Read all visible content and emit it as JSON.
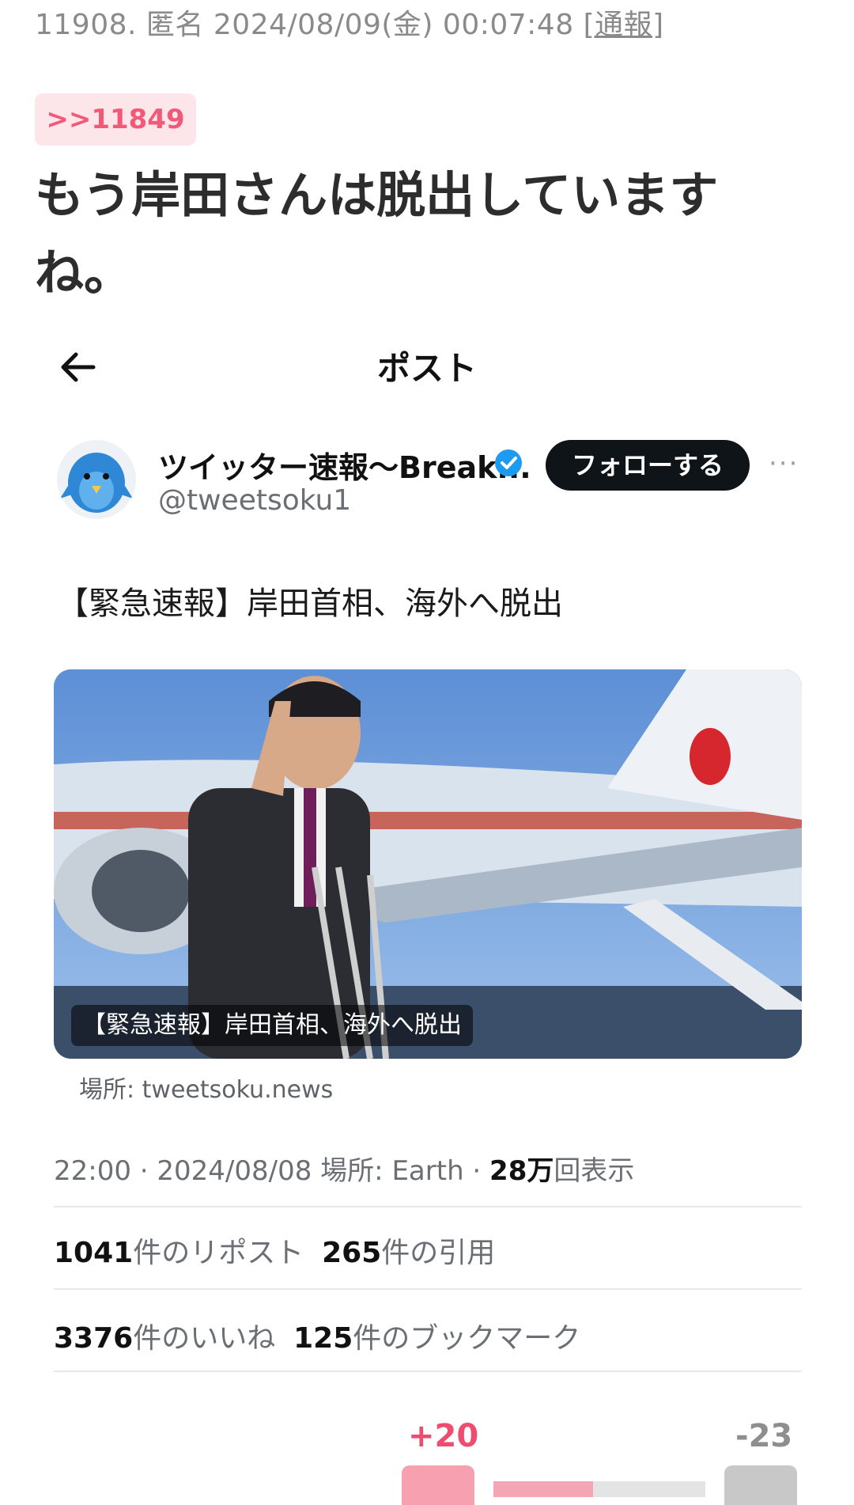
{
  "comment": {
    "number": "11908.",
    "author": "匿名",
    "datetime": "2024/08/09(金) 00:07:48",
    "report_label": "[通報]",
    "reply_anchor": ">>11849",
    "body": "もう岸田さんは脱出していますね。"
  },
  "embed": {
    "header_title": "ポスト",
    "account_name": "ツイッター速報〜Break...",
    "handle": "@tweetsoku1",
    "follow_label": "フォローする",
    "more_label": "···",
    "text": "【緊急速報】岸田首相、海外へ脱出",
    "media_caption": "【緊急速報】岸田首相、海外へ脱出",
    "source": "場所: tweetsoku.news",
    "timeline_prefix": "22:00 · 2024/08/08  場所: Earth · ",
    "views_count": "28万",
    "views_suffix": "回表示",
    "reposts_count": "1041",
    "reposts_label": "件のリポスト",
    "quotes_count": "265",
    "quotes_label": "件の引用",
    "likes_count": "3376",
    "likes_label": "件のいいね",
    "bookmarks_count": "125",
    "bookmarks_label": "件のブックマーク"
  },
  "votes": {
    "plus": "+20",
    "minus": "-23",
    "plus_ratio": 0.47
  },
  "colors": {
    "accent_pink": "#ef4c70",
    "anchor_bg": "#fde6ea",
    "follow_bg": "#0f1419",
    "verified_blue": "#1d9bf0"
  }
}
